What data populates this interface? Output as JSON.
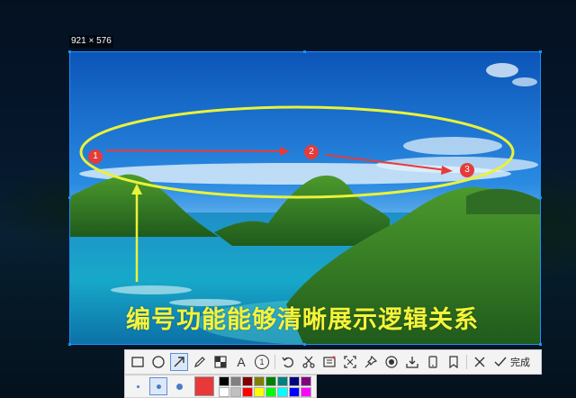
{
  "selection": {
    "size_text": "921 × 576"
  },
  "annotations": {
    "markers": [
      "1",
      "2",
      "3"
    ],
    "caption": "编号功能能够清晰展示逻辑关系",
    "colors": {
      "ellipse": "#eaf23a",
      "arrow": "#e53b3b",
      "marker_fill": "#e53b3b",
      "caption": "#f6f33a"
    }
  },
  "toolbar": {
    "tools": [
      {
        "name": "rectangle-tool",
        "icon": "rectangle-icon"
      },
      {
        "name": "ellipse-tool",
        "icon": "ellipse-icon"
      },
      {
        "name": "arrow-tool",
        "icon": "arrow-icon",
        "active": true
      },
      {
        "name": "pencil-tool",
        "icon": "pencil-icon"
      },
      {
        "name": "mosaic-tool",
        "icon": "mosaic-icon"
      },
      {
        "name": "text-tool",
        "icon": "text-icon",
        "glyph": "A"
      },
      {
        "name": "number-tool",
        "icon": "number-marker-icon",
        "glyph": "1"
      },
      {
        "name": "undo-tool",
        "icon": "undo-icon"
      },
      {
        "name": "scissors-tool",
        "icon": "scissors-icon"
      },
      {
        "name": "ocr-tool",
        "icon": "ocr-icon"
      },
      {
        "name": "crop-tool",
        "icon": "crop-icon"
      },
      {
        "name": "pin-tool",
        "icon": "pin-icon"
      },
      {
        "name": "record-tool",
        "icon": "record-icon"
      },
      {
        "name": "download-tool",
        "icon": "download-icon"
      },
      {
        "name": "phone-tool",
        "icon": "phone-icon"
      },
      {
        "name": "bookmark-tool",
        "icon": "bookmark-icon"
      }
    ],
    "cancel_icon": "close-icon",
    "done_label": "完成"
  },
  "options": {
    "current_color": "#e8393a",
    "palette": [
      "#000000",
      "#808080",
      "#800000",
      "#808000",
      "#008000",
      "#008080",
      "#000080",
      "#800080",
      "#ffffff",
      "#c0c0c0",
      "#ff0000",
      "#ffff00",
      "#00ff00",
      "#00ffff",
      "#0000ff",
      "#ff00ff"
    ]
  }
}
